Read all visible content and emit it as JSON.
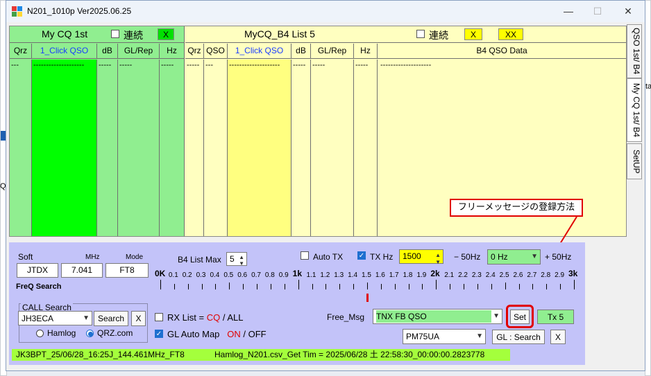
{
  "window": {
    "title": "N201_1010p   Ver2025.06.25",
    "minimize": "—",
    "maximize": "☐",
    "close": "✕"
  },
  "bg_fragments": [
    "ta",
    "m",
    "Q",
    "pr"
  ],
  "mycq": {
    "title": "My CQ  1st",
    "renzoku": "連続",
    "x_label": "X",
    "columns": [
      "Qrz",
      "1_Click QSO",
      "dB",
      "GL/Rep",
      "Hz"
    ],
    "row": [
      "---",
      "--------------------",
      "-----",
      "-----",
      "-----"
    ]
  },
  "b4": {
    "title": "MyCQ_B4   List  5",
    "renzoku": "連続",
    "x_label": "X",
    "xx_label": "XX",
    "columns": [
      "Qrz",
      "QSO",
      "1_Click QSO",
      "dB",
      "GL/Rep",
      "Hz",
      "B4 QSO Data"
    ],
    "row": [
      "-----",
      "---",
      "--------------------",
      "-----",
      "-----",
      "-----",
      "--------------------"
    ]
  },
  "tabs": [
    "QSO 1st/ B4",
    "My CQ 1st/ B4",
    "SetUP"
  ],
  "soft": {
    "label": "Soft",
    "value": "JTDX"
  },
  "mhz": {
    "label": "MHz",
    "value": "7.041"
  },
  "mode": {
    "label": "Mode",
    "value": "FT8"
  },
  "freq_search": "FreQ Search",
  "b4_list_max": {
    "label": "B4 List Max",
    "value": "5"
  },
  "auto_tx": "Auto TX",
  "tx_hz": {
    "label": "TX Hz",
    "value": "1500"
  },
  "minus50": "− 50Hz",
  "plus50": "+ 50Hz",
  "offset_select": "0 Hz",
  "scale": {
    "labels": [
      "0K",
      "0.1",
      "0.2",
      "0.3",
      "0.4",
      "0.5",
      "0.6",
      "0.7",
      "0.8",
      "0.9",
      "1k",
      "1.1",
      "1.2",
      "1.3",
      "1.4",
      "1.5",
      "1.6",
      "1.7",
      "1.8",
      "1.9",
      "2k",
      "2.1",
      "2.2",
      "2.3",
      "2.4",
      "2.5",
      "2.6",
      "2.7",
      "2.8",
      "2.9",
      "3k"
    ],
    "marker_hz": 1500
  },
  "call_search": {
    "group": "CALL Search",
    "value": "JH3ECA",
    "search": "Search",
    "x": "X",
    "hamlog": "Hamlog",
    "qrz": "QRZ.com"
  },
  "rx_list": {
    "label": "RX List =",
    "cq": "CQ",
    "slash": "/",
    "all": "ALL"
  },
  "gl_auto_map": {
    "label": "GL Auto Map",
    "on": "ON",
    "slash": "/",
    "off": "OFF"
  },
  "free_msg": {
    "label": "Free_Msg",
    "value": "TNX FB QSO",
    "set": "Set",
    "tx5": "Tx 5"
  },
  "grid_select": "PM75UA",
  "gl_search": "GL : Search",
  "gl_x": "X",
  "status_left": "JK3BPT_25/06/28_16:25J_144.461MHz_FT8",
  "status_right": "Hamlog_N201.csv_Get Tim = 2025/06/28 土 22:58:30_00:00:00.2823778",
  "annotation": "フリーメッセージの登録方法",
  "colors": {
    "green": "#00ff00",
    "lightgreen": "#90ee90",
    "paleyellow": "#ffffc0",
    "yellow": "#ffff80",
    "bottom": "#c3c3f9",
    "red": "#e00000"
  }
}
